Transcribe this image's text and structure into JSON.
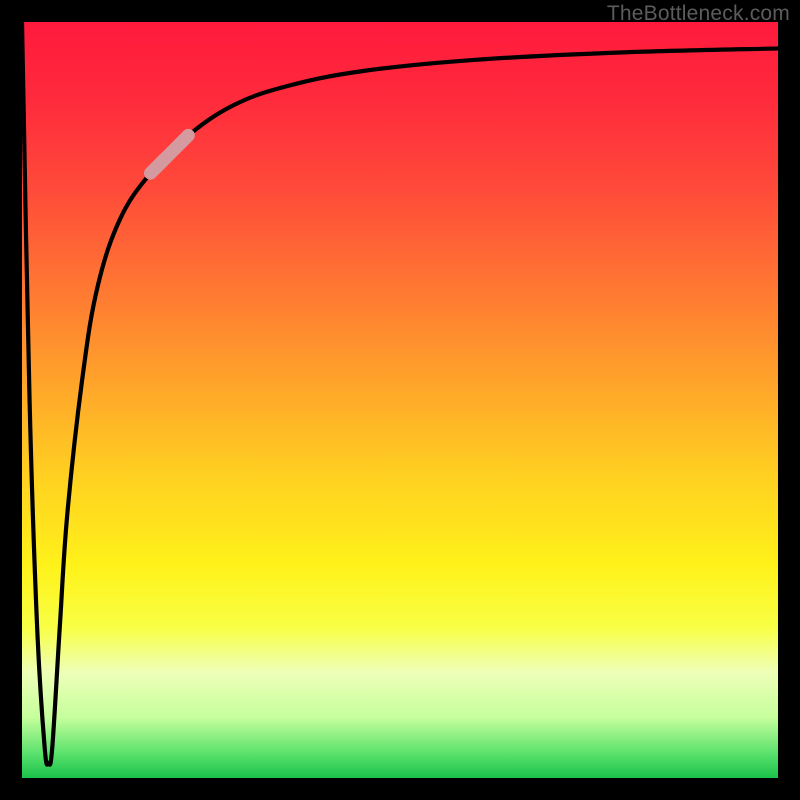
{
  "attribution": "TheBottleneck.com",
  "chart_data": {
    "type": "line",
    "title": "",
    "xlabel": "",
    "ylabel": "",
    "xlim": [
      0,
      100
    ],
    "ylim": [
      0,
      100
    ],
    "grid": false,
    "series": [
      {
        "name": "bottleneck-curve",
        "x": [
          0,
          1,
          2,
          3,
          3.5,
          4,
          5,
          6,
          8,
          10,
          13,
          17,
          22,
          28,
          35,
          45,
          60,
          80,
          100
        ],
        "y": [
          100,
          50,
          20,
          4,
          2,
          4,
          20,
          35,
          53,
          65,
          74,
          80,
          85,
          89,
          91.5,
          93.5,
          95,
          96,
          96.5
        ]
      }
    ],
    "highlight_segment": {
      "x_start": 17,
      "x_end": 22
    },
    "gradient_stops": [
      {
        "pos": 0,
        "color": "#ff1a3d"
      },
      {
        "pos": 36,
        "color": "#ff7a32"
      },
      {
        "pos": 72,
        "color": "#fff21a"
      },
      {
        "pos": 92,
        "color": "#c6ff9c"
      },
      {
        "pos": 100,
        "color": "#1bc24b"
      }
    ]
  }
}
